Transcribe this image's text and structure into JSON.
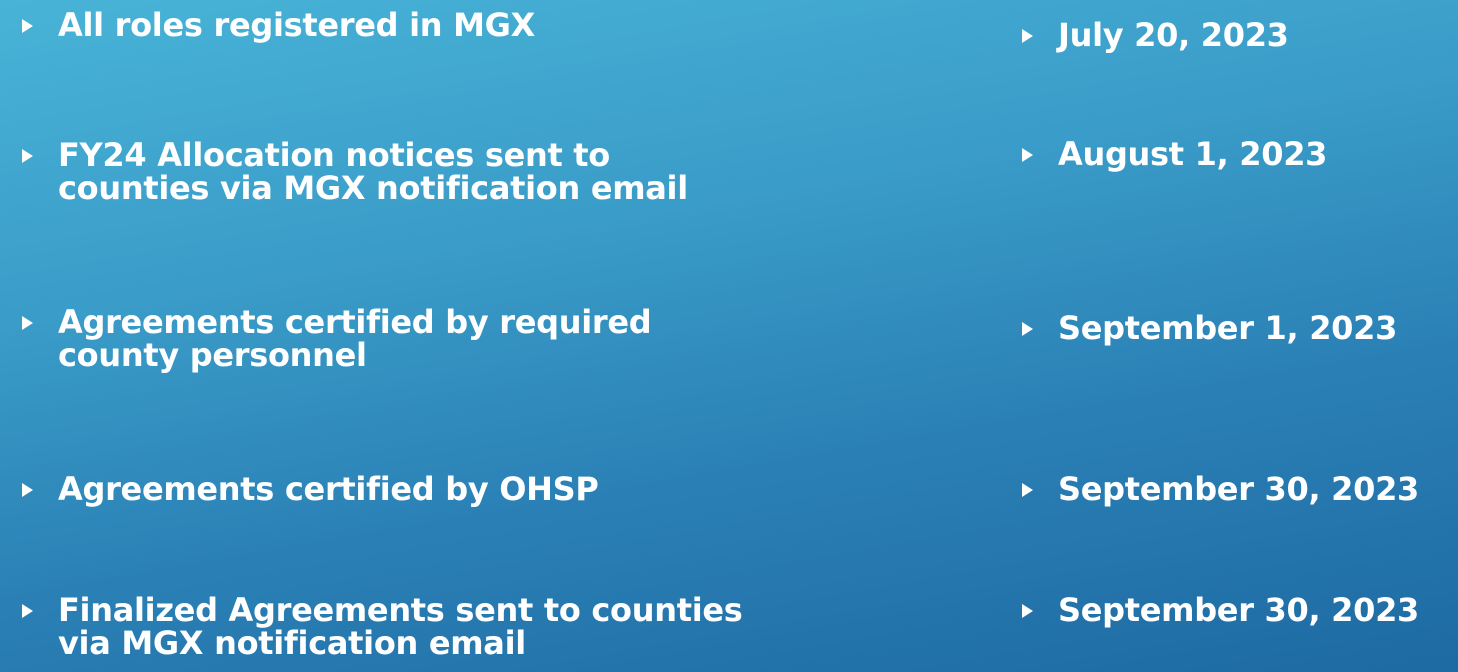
{
  "milestones": [
    {
      "task_lines": [
        "All roles registered in MGX"
      ],
      "date": "July 20, 2023"
    },
    {
      "task_lines": [
        "FY24 Allocation notices sent to",
        "counties via MGX notification email"
      ],
      "date": "August 1, 2023"
    },
    {
      "task_lines": [
        "Agreements certified by required",
        "county personnel"
      ],
      "date": "September 1, 2023"
    },
    {
      "task_lines": [
        "Agreements certified by OHSP"
      ],
      "date": "September 30, 2023"
    },
    {
      "task_lines": [
        "Finalized Agreements sent to counties",
        "via MGX notification email"
      ],
      "date": "September 30, 2023"
    }
  ],
  "icons": {
    "bullet": "triangle-right-bullet-icon"
  },
  "colors": {
    "background_top": "#48b3d7",
    "background_bottom": "#1e6aa3",
    "text": "#ffffff"
  }
}
